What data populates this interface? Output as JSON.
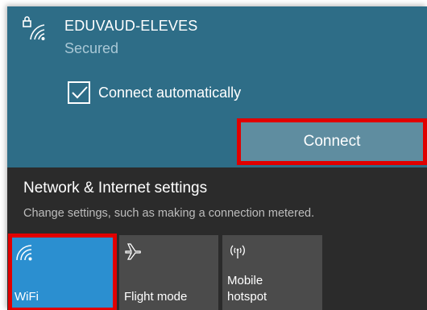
{
  "network": {
    "ssid": "EDUVAUD-ELEVES",
    "status": "Secured",
    "auto_connect_label": "Connect automatically",
    "auto_connect_checked": true,
    "connect_button": "Connect",
    "icon": "wifi-secured-icon"
  },
  "settings": {
    "title": "Network & Internet settings",
    "description": "Change settings, such as making a connection metered."
  },
  "quick_actions": [
    {
      "label": "WiFi",
      "icon": "wifi-icon",
      "active": true
    },
    {
      "label": "Flight mode",
      "icon": "airplane-icon",
      "active": false
    },
    {
      "label": "Mobile hotspot",
      "label_line1": "Mobile",
      "label_line2": "hotspot",
      "icon": "hotspot-icon",
      "active": false
    }
  ],
  "colors": {
    "network_panel": "#2e6d87",
    "connect_button": "#5f8da0",
    "highlight": "#e00000",
    "wifi_tile_active": "#2b8fd0",
    "tile_inactive": "#4b4b4b",
    "dark_background": "#2b2b2b"
  }
}
